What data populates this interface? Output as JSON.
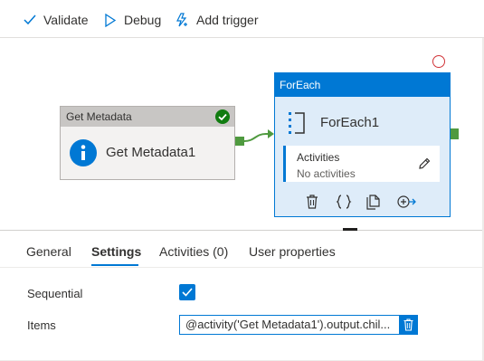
{
  "toolbar": {
    "validate_label": "Validate",
    "debug_label": "Debug",
    "add_trigger_label": "Add trigger"
  },
  "canvas": {
    "get_metadata": {
      "type_label": "Get Metadata",
      "name": "Get Metadata1",
      "status": "succeeded"
    },
    "foreach": {
      "type_label": "ForEach",
      "name": "ForEach1",
      "activities_title": "Activities",
      "activities_subtitle": "No activities"
    }
  },
  "tabs": [
    {
      "label": "General",
      "active": false
    },
    {
      "label": "Settings",
      "active": true
    },
    {
      "label": "Activities (0)",
      "active": false
    },
    {
      "label": "User properties",
      "active": false
    }
  ],
  "settings": {
    "sequential_label": "Sequential",
    "sequential_checked": true,
    "items_label": "Items",
    "items_value": "@activity('Get Metadata1').output.chil..."
  },
  "colors": {
    "accent": "#0078d4",
    "success": "#107c10",
    "connector": "#4f9a3f",
    "error": "#d13438"
  }
}
